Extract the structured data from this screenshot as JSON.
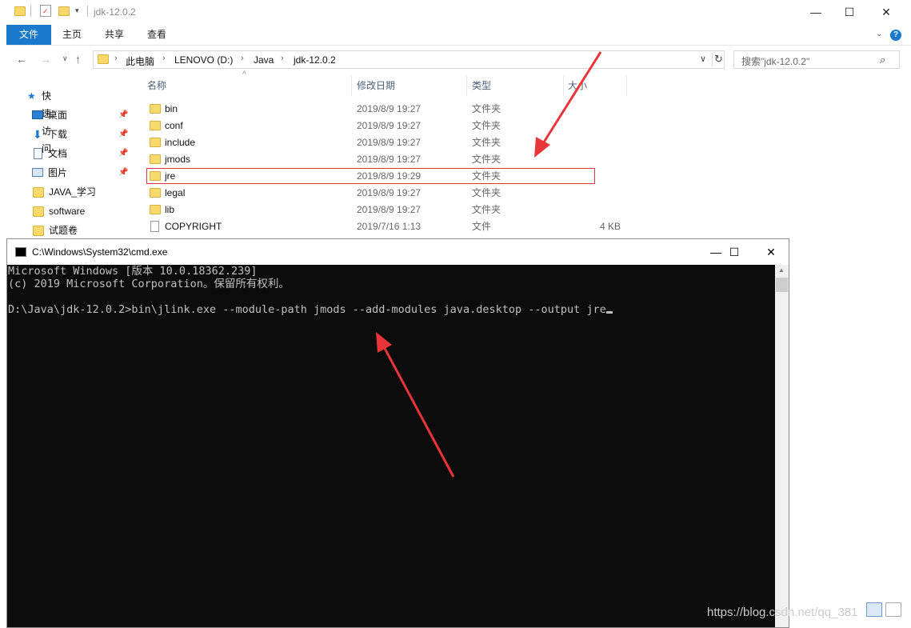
{
  "explorer": {
    "title": "jdk-12.0.2",
    "ribbon_tabs": {
      "file": "文件",
      "home": "主页",
      "share": "共享",
      "view": "查看"
    },
    "breadcrumb": [
      "此电脑",
      "LENOVO (D:)",
      "Java",
      "jdk-12.0.2"
    ],
    "search_placeholder": "搜索\"jdk-12.0.2\"",
    "nav_items": {
      "quick_access": "快速访问",
      "desktop": "桌面",
      "downloads": "下载",
      "documents": "文档",
      "pictures": "图片",
      "java_study": "JAVA_学习",
      "software": "software",
      "exams": "试题卷"
    },
    "columns": {
      "name": "名称",
      "date": "修改日期",
      "type": "类型",
      "size": "大小"
    },
    "files": [
      {
        "name": "bin",
        "date": "2019/8/9 19:27",
        "type": "文件夹",
        "size": ""
      },
      {
        "name": "conf",
        "date": "2019/8/9 19:27",
        "type": "文件夹",
        "size": ""
      },
      {
        "name": "include",
        "date": "2019/8/9 19:27",
        "type": "文件夹",
        "size": ""
      },
      {
        "name": "jmods",
        "date": "2019/8/9 19:27",
        "type": "文件夹",
        "size": ""
      },
      {
        "name": "jre",
        "date": "2019/8/9 19:29",
        "type": "文件夹",
        "size": ""
      },
      {
        "name": "legal",
        "date": "2019/8/9 19:27",
        "type": "文件夹",
        "size": ""
      },
      {
        "name": "lib",
        "date": "2019/8/9 19:27",
        "type": "文件夹",
        "size": ""
      },
      {
        "name": "COPYRIGHT",
        "date": "2019/7/16 1:13",
        "type": "文件",
        "size": "4 KB"
      }
    ]
  },
  "cmd": {
    "title": "C:\\Windows\\System32\\cmd.exe",
    "line1": "Microsoft Windows [版本 10.0.18362.239]",
    "line2": "(c) 2019 Microsoft Corporation。保留所有权利。",
    "line3": "",
    "line4": "D:\\Java\\jdk-12.0.2>bin\\jlink.exe --module-path jmods --add-modules java.desktop --output jre"
  },
  "watermark": "https://blog.csdn.net/qq_381",
  "annotation_color": "#e8353a"
}
